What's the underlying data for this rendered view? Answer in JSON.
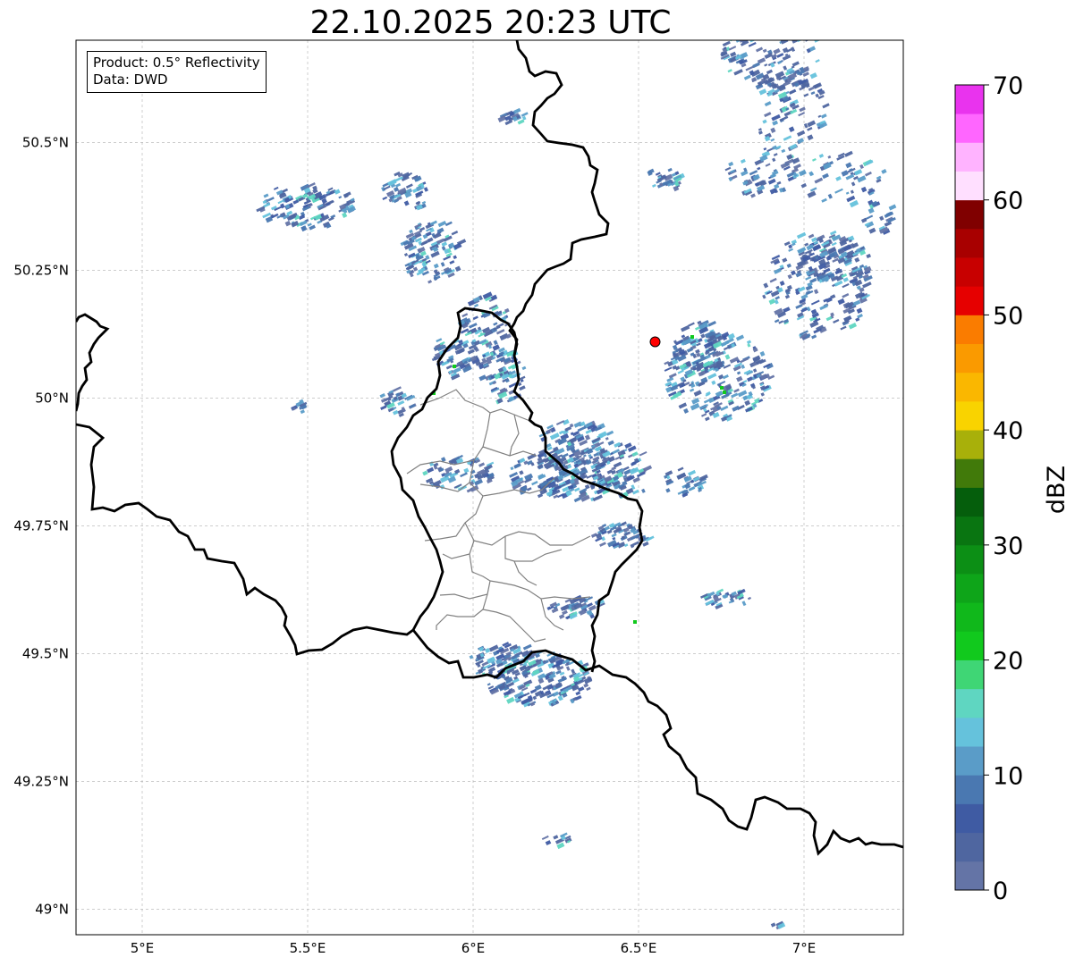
{
  "title": "22.10.2025 20:23 UTC",
  "info": {
    "product_line": "Product: 0.5° Reflectivity",
    "data_line": "Data: DWD"
  },
  "axes": {
    "x_ticks": [
      "5°E",
      "5.5°E",
      "6°E",
      "6.5°E",
      "7°E"
    ],
    "y_ticks": [
      "50.5°N",
      "50.25°N",
      "50°N",
      "49.75°N",
      "49.5°N",
      "49.25°N",
      "49°N"
    ],
    "lon_values": [
      5.0,
      5.5,
      6.0,
      6.5,
      7.0
    ],
    "lat_values": [
      50.5,
      50.25,
      50.0,
      49.75,
      49.5,
      49.25,
      49.0
    ],
    "lon_range": [
      4.8,
      7.3
    ],
    "lat_range": [
      48.95,
      50.7
    ],
    "grid": true
  },
  "colorbar": {
    "title": "dBZ",
    "ticks": [
      "0",
      "10",
      "20",
      "30",
      "40",
      "50",
      "60",
      "70"
    ],
    "range": [
      0,
      70
    ],
    "colors": [
      "#6474a6",
      "#4f66a0",
      "#3f5ba3",
      "#4a78b1",
      "#5a9cc8",
      "#65c2dc",
      "#5fd6c1",
      "#3fd675",
      "#11c91d",
      "#10b81b",
      "#0ea519",
      "#0c8f15",
      "#097511",
      "#055e0c",
      "#417a0a",
      "#a8b00a",
      "#f9d300",
      "#fab700",
      "#fa9a00",
      "#fa7c00",
      "#e60000",
      "#c80000",
      "#a80000",
      "#800000",
      "#ffdfff",
      "#ffb3ff",
      "#ff66ff",
      "#e933ee"
    ],
    "step_dbz": 2.5
  },
  "marker": {
    "label": "",
    "lon": 6.55,
    "lat": 50.11,
    "color": "#ff0000"
  },
  "colors": {
    "border": "#000000",
    "admin": "#808080",
    "grid": "#b0b0b0"
  }
}
